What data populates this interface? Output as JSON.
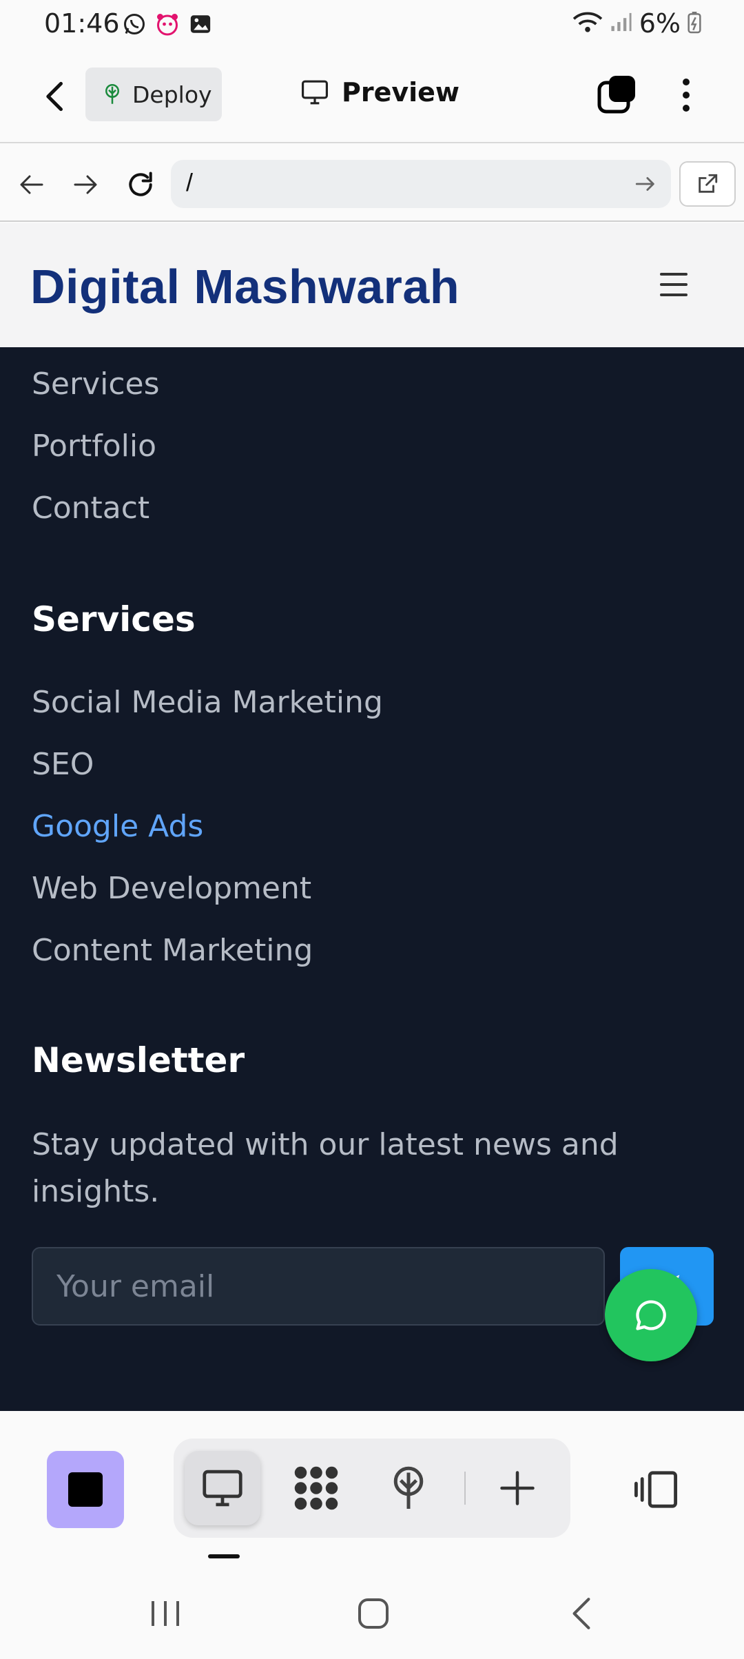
{
  "status_bar": {
    "time": "01:46",
    "battery": "6%",
    "left_icons": [
      "whatsapp-icon",
      "foodpanda-icon",
      "gallery-icon"
    ],
    "right_icons": [
      "wifi-icon",
      "signal-icon",
      "battery-charging-icon"
    ]
  },
  "app_bar": {
    "deploy_label": "Deploy",
    "preview_label": "Preview"
  },
  "browser": {
    "url": "/"
  },
  "site": {
    "logo": "Digital Mashwarah"
  },
  "footer": {
    "quick_links": [
      {
        "label": "Services"
      },
      {
        "label": "Portfolio"
      },
      {
        "label": "Contact"
      }
    ],
    "services_heading": "Services",
    "services": [
      {
        "label": "Social Media Marketing"
      },
      {
        "label": "SEO"
      },
      {
        "label": "Google Ads"
      },
      {
        "label": "Web Development"
      },
      {
        "label": "Content Marketing"
      }
    ],
    "newsletter_heading": "Newsletter",
    "newsletter_text": "Stay updated with our latest news and insights.",
    "email_placeholder": "Your email"
  },
  "colors": {
    "footer_bg": "#111827",
    "link_active": "#60a5fa",
    "logo": "#13307a",
    "send_button": "#2196f3",
    "chat_fab": "#22c55e",
    "app_square": "#b4a7fb"
  },
  "toolbar": {
    "tools": [
      "monitor-icon",
      "apps-grid-icon",
      "deploy-tree-icon",
      "plus-icon"
    ],
    "selected": "monitor-icon"
  }
}
